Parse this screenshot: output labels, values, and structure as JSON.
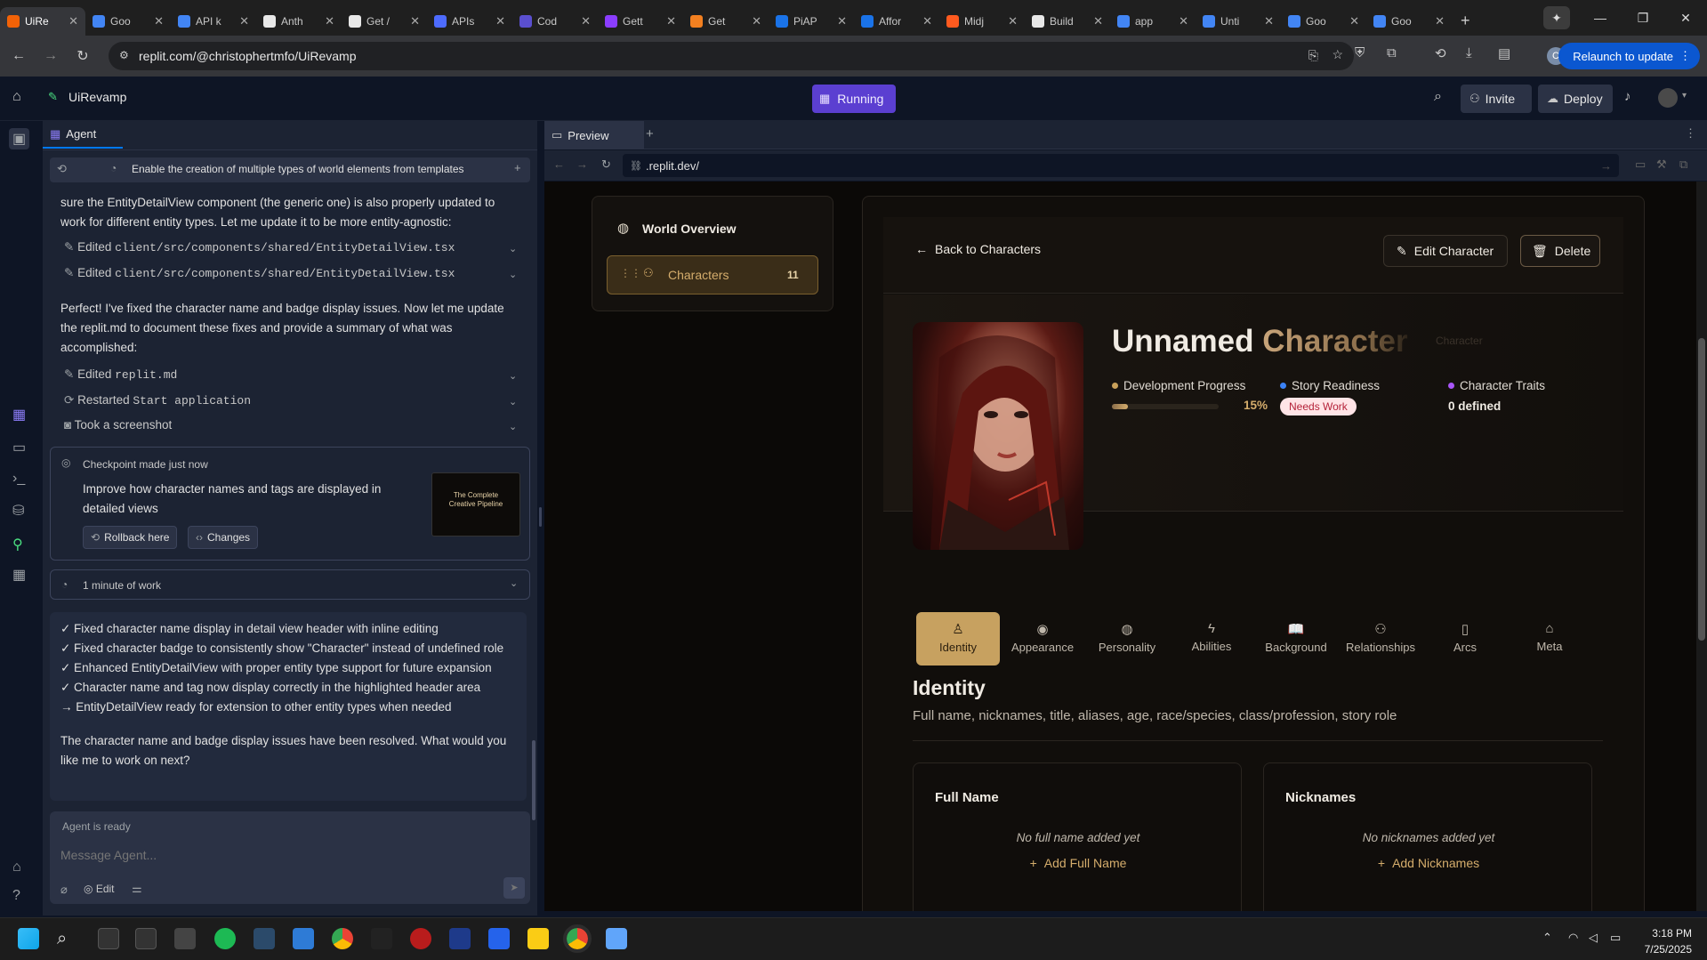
{
  "browser": {
    "tabs": [
      {
        "label": "UiRe",
        "color": "#f26207",
        "active": true
      },
      {
        "label": "Goo",
        "color": "#4285f4"
      },
      {
        "label": "API k",
        "color": "#4285f4"
      },
      {
        "label": "Anth",
        "color": "#e8e8e8"
      },
      {
        "label": "Get /",
        "color": "#e8e8e8"
      },
      {
        "label": "APIs",
        "color": "#4d6bfe"
      },
      {
        "label": "Cod",
        "color": "#5a4fcf"
      },
      {
        "label": "Gett",
        "color": "#8b3dff"
      },
      {
        "label": "Get",
        "color": "#f38020"
      },
      {
        "label": "PiAP",
        "color": "#1a73e8"
      },
      {
        "label": "Affor",
        "color": "#1a73e8"
      },
      {
        "label": "Midj",
        "color": "#ff5a1f"
      },
      {
        "label": "Build",
        "color": "#e8e8e8"
      },
      {
        "label": "app",
        "color": "#4285f4"
      },
      {
        "label": "Unti",
        "color": "#4285f4"
      },
      {
        "label": "Goo",
        "color": "#4285f4"
      },
      {
        "label": "Goo",
        "color": "#4285f4"
      }
    ],
    "new_tab_label": "+",
    "url": "replit.com/@christophertmfo/UiRevamp",
    "relaunch_label": "Relaunch to update",
    "profile_initial": "C"
  },
  "replit": {
    "project_name": "UiRevamp",
    "run_status": "Running",
    "invite_label": "Invite",
    "deploy_label": "Deploy",
    "agent_tab_label": "Agent",
    "preview_tab_label": "Preview",
    "preview_url": ".replit.dev/",
    "checkpoint_banner": "Enable the creation of multiple types of world elements from templates",
    "agent_msg_1": "sure the EntityDetailView component (the generic one) is also properly updated to work for different entity types. Let me update it to be more entity-agnostic:",
    "edit_1_label": "Edited",
    "edit_1_file": "client/src/components/shared/EntityDetailView.tsx",
    "edit_2_label": "Edited",
    "edit_2_file": "client/src/components/shared/EntityDetailView.tsx",
    "agent_msg_2": "Perfect! I've fixed the character name and badge display issues. Now let me update the replit.md to document these fixes and provide a summary of what was accomplished:",
    "edit_3_label": "Edited",
    "edit_3_file": "replit.md",
    "restart_label": "Restarted",
    "restart_target": "Start application",
    "screenshot_label": "Took a screenshot",
    "checkpoint_label": "Checkpoint made",
    "checkpoint_time": "just now",
    "checkpoint_desc": "Improve how character names and tags are displayed in detailed views",
    "rollback_label": "Rollback here",
    "changes_label": "Changes",
    "thumb_title": "The Complete Creative Pipeline",
    "work_duration": "1 minute of work",
    "summary_lines": [
      "✓ Fixed character name display in detail view header with inline editing",
      "✓ Fixed character badge to consistently show \"Character\" instead of undefined role",
      "✓ Enhanced EntityDetailView with proper entity type support for future expansion",
      "✓ Character name and tag now display correctly in the highlighted header area",
      "→ EntityDetailView ready for extension to other entity types when needed"
    ],
    "closing_msg": "The character name and badge display issues have been resolved. What would you like me to work on next?",
    "agent_status": "Agent is ready",
    "message_placeholder": "Message Agent...",
    "edit_label": "Edit"
  },
  "site": {
    "sidebar_title": "World Overview",
    "sidebar_item": "Characters",
    "sidebar_count": "11",
    "back_label": "Back to Characters",
    "edit_label": "Edit Character",
    "delete_label": "Delete",
    "character_name_first": "Unnamed",
    "character_name_second": "Character",
    "character_badge": "Character",
    "dev_progress_label": "Development Progress",
    "dev_progress_value": "15%",
    "dev_progress_fraction": 0.15,
    "story_label": "Story Readiness",
    "story_value": "Needs Work",
    "traits_label": "Character Traits",
    "traits_value": "0 defined",
    "tabs": [
      "Identity",
      "Appearance",
      "Personality",
      "Abilities",
      "Background",
      "Relationships",
      "Arcs",
      "Meta"
    ],
    "section_title": "Identity",
    "section_desc": "Full name, nicknames, title, aliases, age, race/species, class/profession, story role",
    "card1_title": "Full Name",
    "card1_empty": "No full name added yet",
    "card1_action": "Add Full Name",
    "card2_title": "Nicknames",
    "card2_empty": "No nicknames added yet",
    "card2_action": "Add Nicknames",
    "colors": {
      "gold": "#d5ad6c",
      "dot_gold": "#c9a15a",
      "dot_blue": "#3b82f6",
      "dot_purple": "#a855f7",
      "badge": "#ffe4e6"
    }
  },
  "taskbar": {
    "time": "3:18 PM",
    "date": "7/25/2025"
  }
}
